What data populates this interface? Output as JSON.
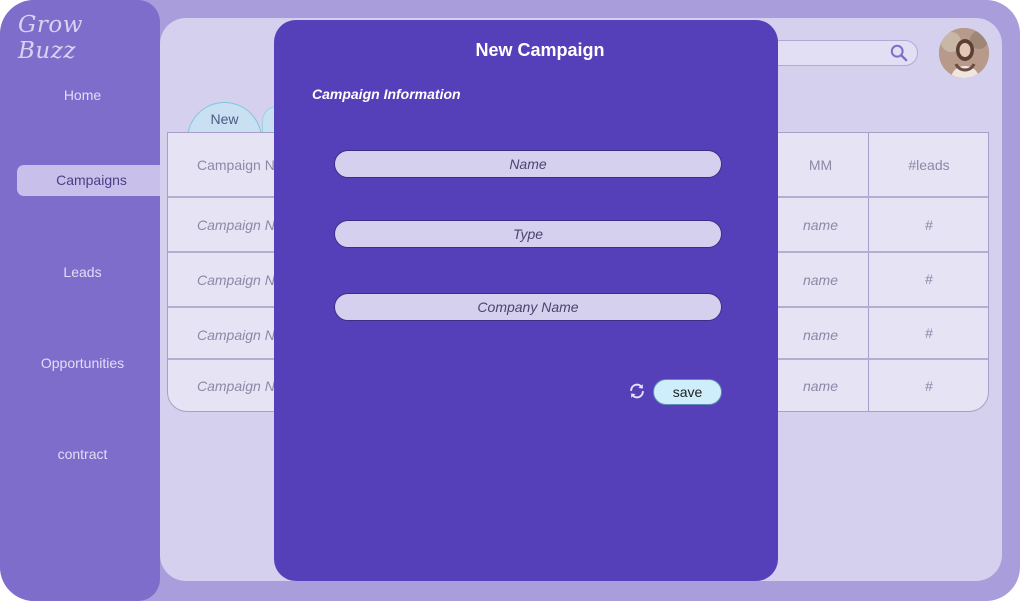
{
  "app": {
    "logo": "Grow Buzz"
  },
  "sidebar": {
    "items": [
      {
        "label": "Home"
      },
      {
        "label": "Campaigns"
      },
      {
        "label": "Leads"
      },
      {
        "label": "Opportunities"
      },
      {
        "label": "contract"
      }
    ],
    "active": "Campaigns"
  },
  "tabs": {
    "new_label": "New"
  },
  "table": {
    "headers": {
      "campaign": "Campaign Na",
      "mm": "MM",
      "leads": "#leads"
    },
    "rows": [
      {
        "campaign": "Campaign Na",
        "mm": "name",
        "leads": "#"
      },
      {
        "campaign": "Campaign Na",
        "mm": "name",
        "leads": "#"
      },
      {
        "campaign": "Campaign Na",
        "mm": "name",
        "leads": "#"
      },
      {
        "campaign": "Campaign Na",
        "mm": "name",
        "leads": "#"
      }
    ]
  },
  "modal": {
    "title": "New Campaign",
    "section": "Campaign Information",
    "fields": {
      "name": "Name",
      "type": "Type",
      "company": "Company Name"
    },
    "save_label": "save"
  },
  "icons": {
    "search": "search-icon",
    "reload": "reload-icon",
    "avatar": "avatar"
  },
  "colors": {
    "accent": "#5540b9",
    "sidebar": "#7e6dcb",
    "content": "#d5d0ee",
    "save_button": "#cdeefa"
  }
}
